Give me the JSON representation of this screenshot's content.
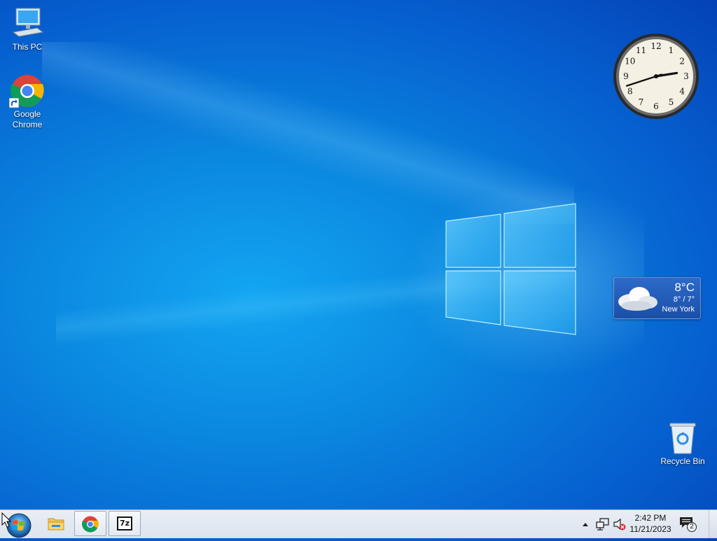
{
  "desktop": {
    "icons": [
      {
        "label": "This PC",
        "icon": "monitor-icon"
      },
      {
        "label": "Google Chrome",
        "label_lines": [
          "Google",
          "Chrome"
        ],
        "icon": "chrome-icon"
      },
      {
        "label": "Recycle Bin",
        "icon": "recycle-bin-icon"
      }
    ]
  },
  "clock_gadget": {
    "numerals": [
      "12",
      "1",
      "2",
      "3",
      "4",
      "5",
      "6",
      "7",
      "8",
      "9",
      "10",
      "11"
    ],
    "time": "2:42"
  },
  "weather_gadget": {
    "temperature": "8°C",
    "range": "8° / 7°",
    "city": "New York",
    "icon": "cloud-icon"
  },
  "taskbar": {
    "start_icon": "windows-orb-icon",
    "pinned": [
      {
        "name": "file-explorer",
        "icon": "folder-icon"
      },
      {
        "name": "chrome",
        "icon": "chrome-icon",
        "active": true
      },
      {
        "name": "7zip",
        "icon": "7zip-icon",
        "text": "7z",
        "active": true
      }
    ],
    "tray": {
      "time": "2:42 PM",
      "date": "11/21/2023",
      "notification_count": "2",
      "icons": [
        "chevron-up-icon",
        "network-icon",
        "volume-muted-icon",
        "action-center-icon"
      ]
    }
  },
  "colors": {
    "desktop_blue": "#0a86df",
    "taskbar": "#e2e8f0",
    "mute_red": "#d9302c"
  }
}
